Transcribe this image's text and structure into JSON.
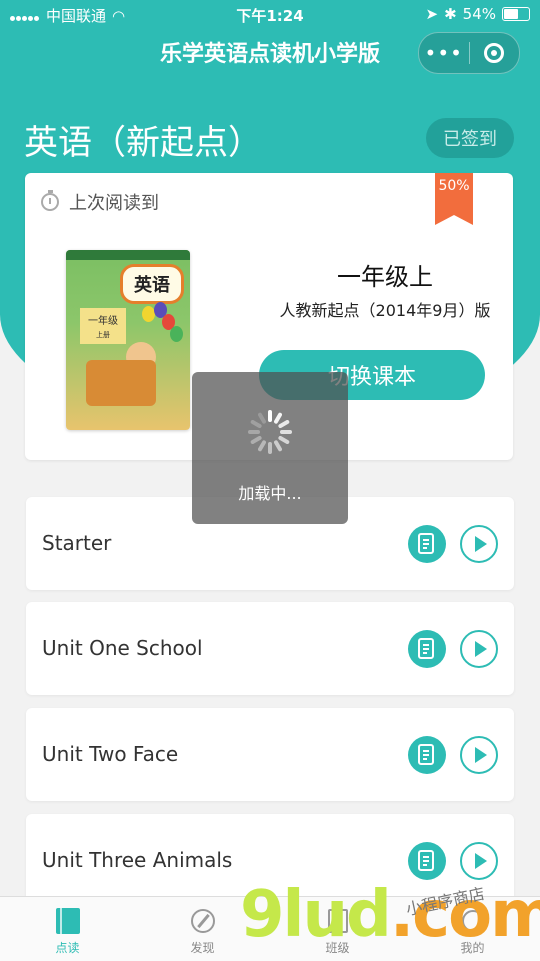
{
  "status_bar": {
    "carrier": "中国联通",
    "time": "下午1:24",
    "battery": "54%"
  },
  "navbar": {
    "title": "乐学英语点读机小学版",
    "more_icon": "more-dots-icon",
    "close_icon": "target-circle-icon"
  },
  "header": {
    "subject": "英语（新起点）",
    "signed_label": "已签到"
  },
  "reading_card": {
    "last_read_label": "上次阅读到",
    "progress_badge": "50%",
    "book_title": "英语",
    "book_grade_cover": "一年级",
    "book_volume_cover": "上册",
    "grade": "一年级上",
    "edition": "人教新起点（2014年9月）版",
    "switch_label": "切换课本"
  },
  "units": [
    {
      "name": "Starter"
    },
    {
      "name": "Unit One School"
    },
    {
      "name": "Unit Two Face"
    },
    {
      "name": "Unit Three Animals"
    }
  ],
  "loading": {
    "text": "加载中..."
  },
  "tabbar": {
    "tabs": [
      {
        "label": "点读",
        "icon": "book-icon",
        "active": true
      },
      {
        "label": "发现",
        "icon": "compass-icon",
        "active": false
      },
      {
        "label": "班级",
        "icon": "class-icon",
        "active": false
      },
      {
        "label": "我的",
        "icon": "profile-icon",
        "active": false
      }
    ]
  },
  "watermark": {
    "brand": "9lud",
    "suffix": ".com",
    "slogan": "小程序商店"
  },
  "colors": {
    "accent": "#2dbcb4",
    "ribbon": "#f26d3d"
  }
}
